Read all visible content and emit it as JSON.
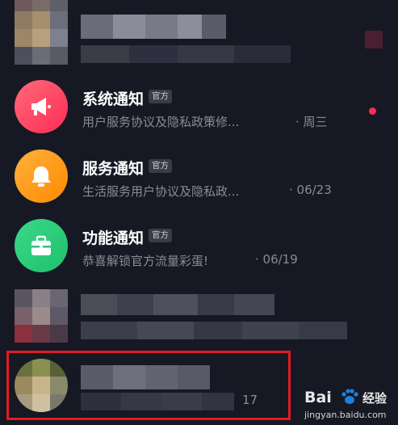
{
  "notifications": [
    {
      "title": "系统通知",
      "badge": "官方",
      "preview": "用户服务协议及隐私政策修...",
      "time": "· 周三",
      "icon": "megaphone-icon",
      "color": "#fe2c55",
      "unread": true
    },
    {
      "title": "服务通知",
      "badge": "官方",
      "preview": "生活服务用户协议及隐私政...",
      "time": "· 06/23",
      "icon": "bell-icon",
      "color": "#ff9a1f",
      "unread": false
    },
    {
      "title": "功能通知",
      "badge": "官方",
      "preview": "恭喜解锁官方流量彩蛋!",
      "time": "· 06/19",
      "icon": "briefcase-icon",
      "color": "#2bd07a",
      "unread": false
    }
  ],
  "blurred_rows": [
    {
      "time_partial": "17"
    }
  ],
  "watermark": {
    "logo": "Bai",
    "logo_suffix": "经验",
    "url": "jingyan.baidu.com"
  },
  "colors": {
    "background": "#161823",
    "highlight_border": "#e31b23",
    "unread_dot": "#fe2c55"
  }
}
